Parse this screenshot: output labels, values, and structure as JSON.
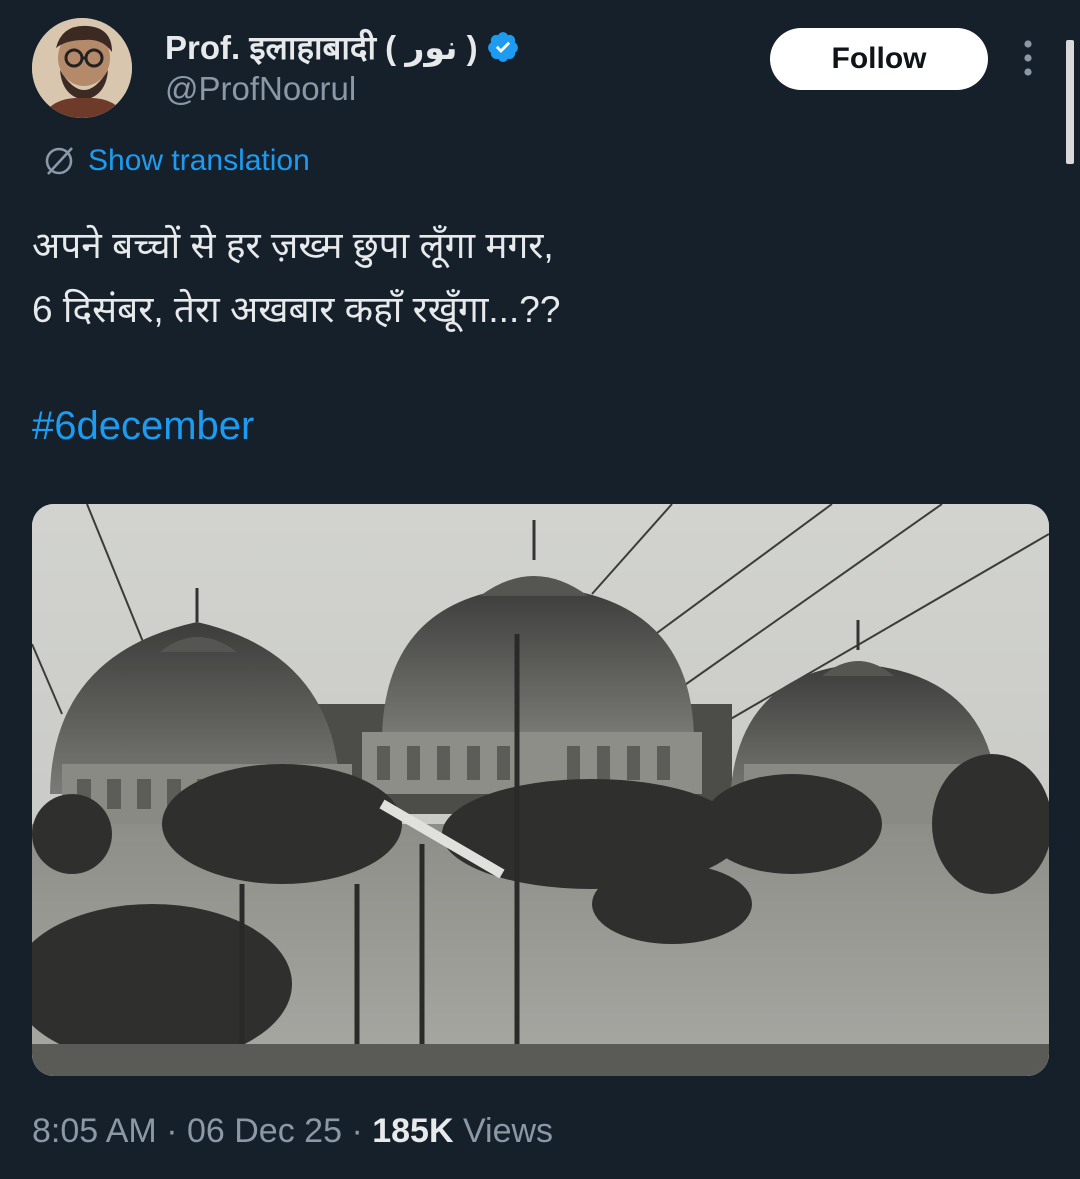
{
  "author": {
    "display_name": "Prof. इलाहाबादी ( نور )",
    "handle": "@ProfNoorul",
    "verified": true
  },
  "actions": {
    "follow_label": "Follow",
    "more_icon": "more-vertical-icon"
  },
  "translation": {
    "label": "Show translation",
    "icon": "globe-slash-icon"
  },
  "tweet": {
    "lines": [
      "अपने बच्चों से हर ज़ख्म छुपा लूँगा मगर,",
      "6 दिसंबर, तेरा अखबार कहाँ रखूँगा...??"
    ],
    "hashtag": "#6december"
  },
  "meta": {
    "time": "8:05 AM",
    "date": "06 Dec 25",
    "views_count": "185K",
    "views_label": "Views",
    "separator": "·"
  },
  "colors": {
    "background": "#15202b",
    "accent": "#1d9bf0",
    "text": "#e7e9ea",
    "muted": "#8b98a5"
  }
}
